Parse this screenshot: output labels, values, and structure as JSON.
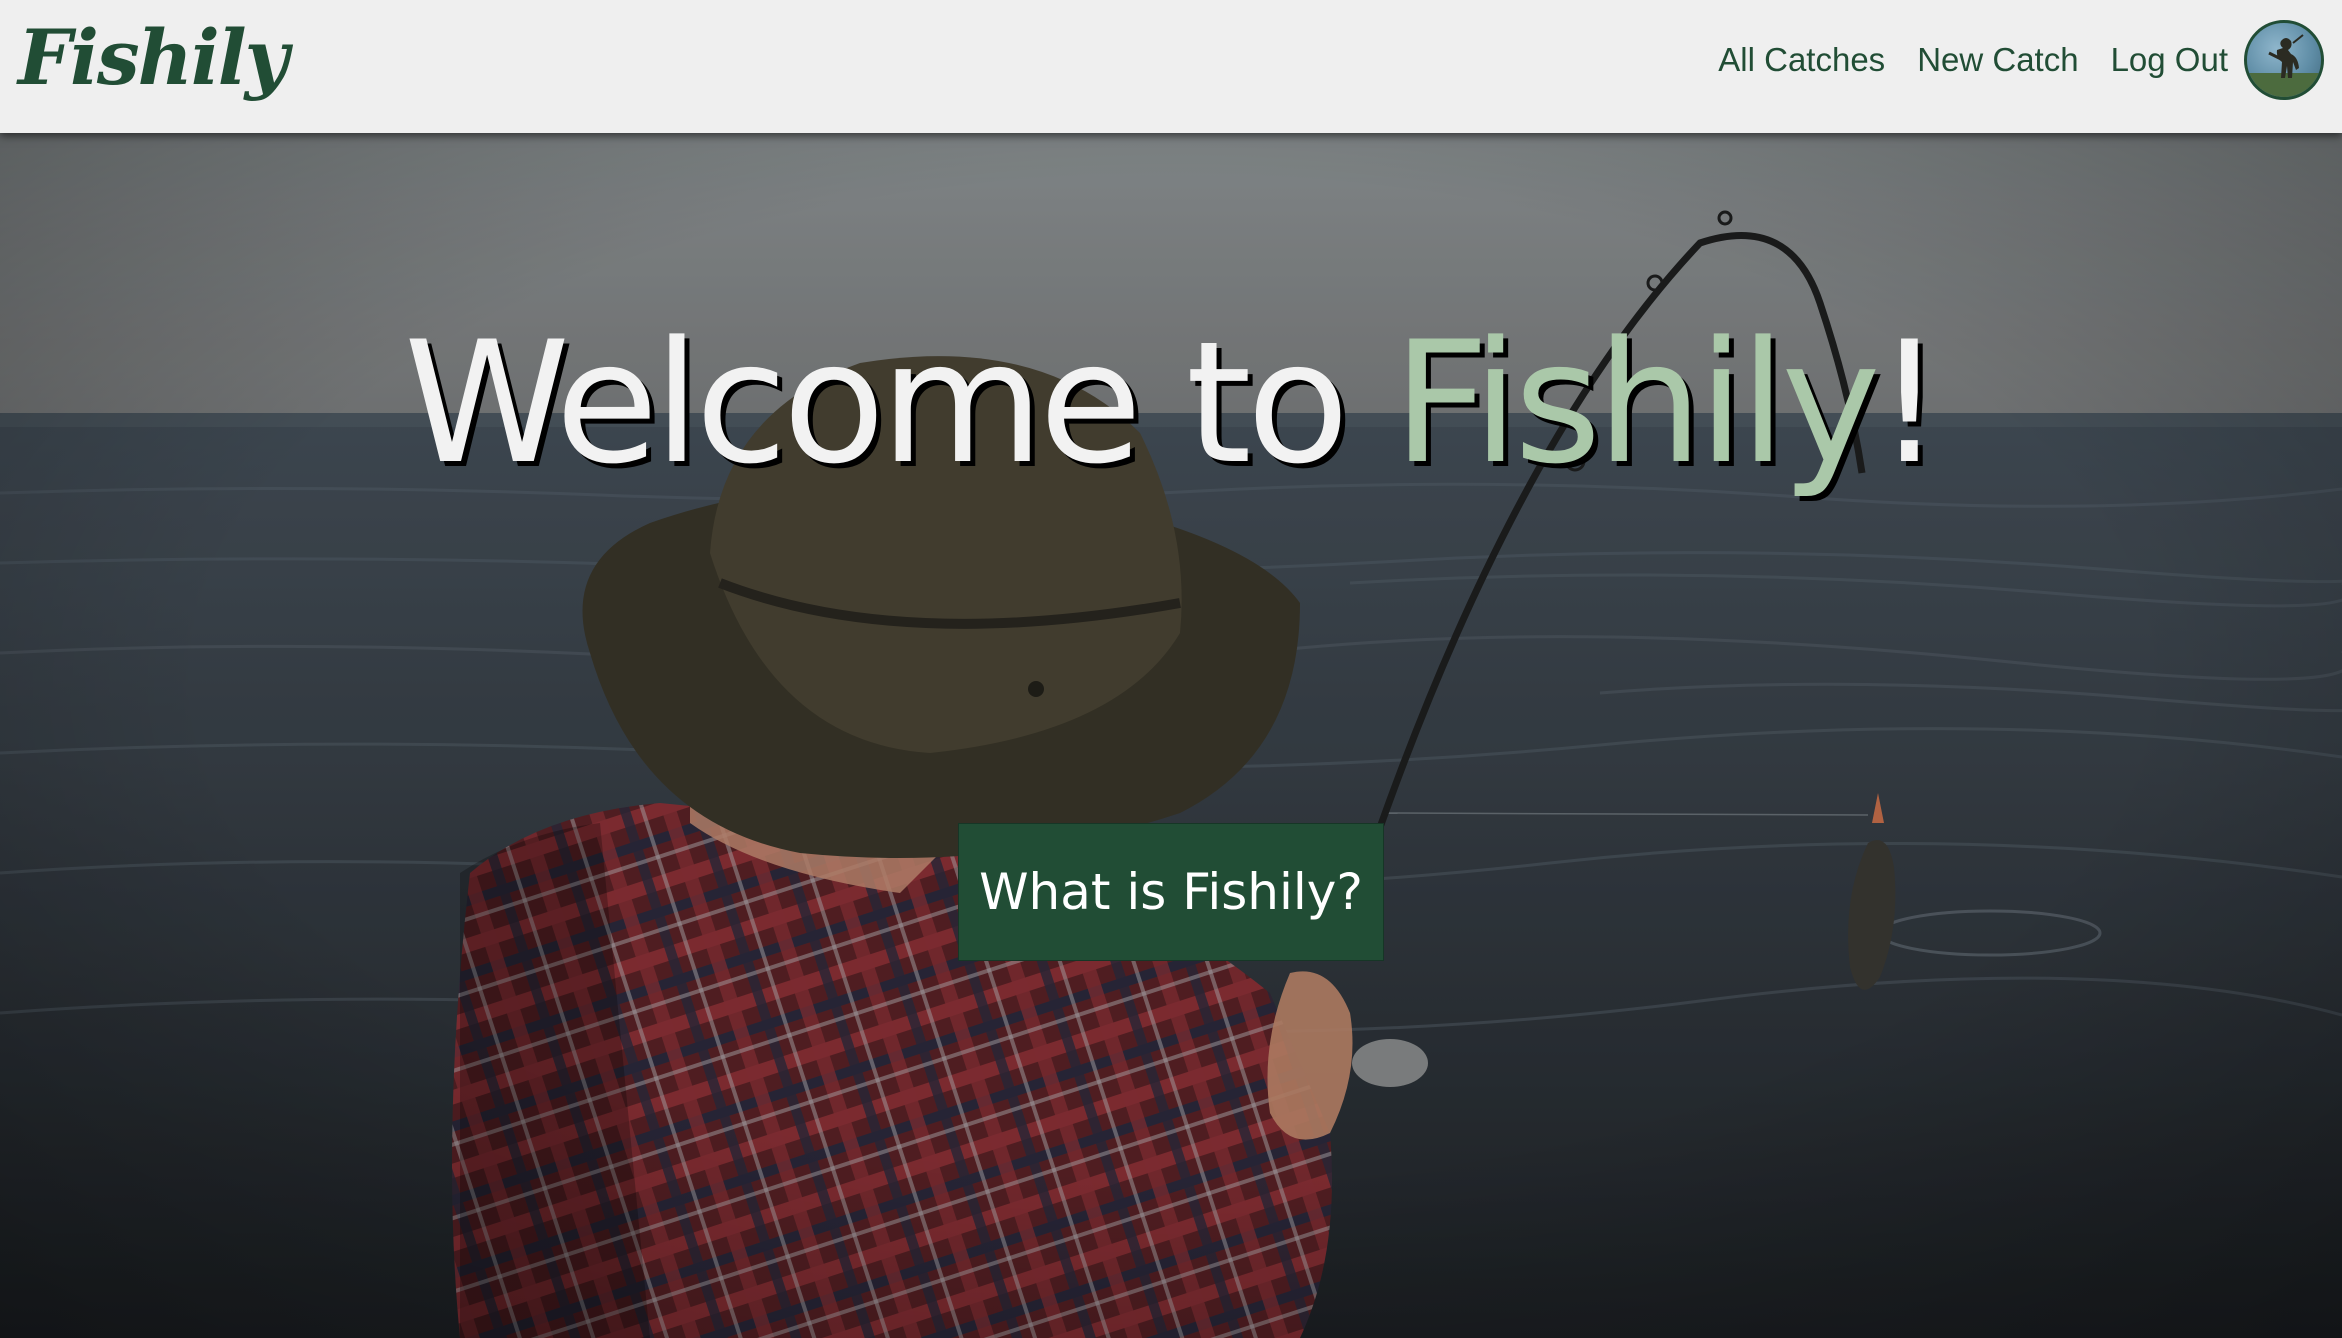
{
  "navbar": {
    "brand": "Fishily",
    "links": [
      "All Catches",
      "New Catch",
      "Log Out"
    ],
    "avatar_icon": "user-avatar-icon"
  },
  "hero": {
    "title_prefix": "Welcome to ",
    "title_accent": "Fishily",
    "title_suffix": "!",
    "cta_label": "What is Fishily?",
    "background_image": "fisherman-at-sea-photo"
  },
  "colors": {
    "brand_green": "#214d35",
    "accent_green": "#aac8a9",
    "navbar_bg": "#efefef",
    "title_white": "#f2f2f2"
  }
}
